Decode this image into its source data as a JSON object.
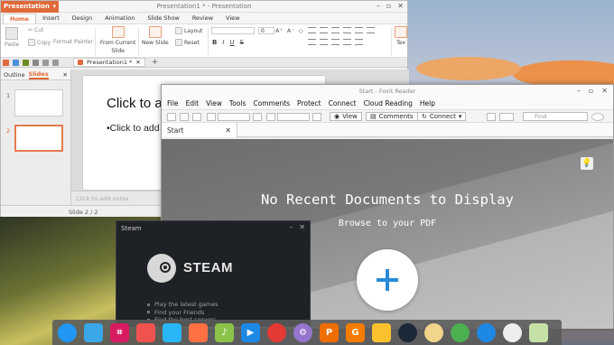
{
  "wps": {
    "app_button": "Presentation",
    "window_title": "Presentation1 * - Presentation",
    "tabs": [
      "Home",
      "Insert",
      "Design",
      "Animation",
      "Slide Show",
      "Review",
      "View"
    ],
    "ribbon": {
      "paste": "Paste",
      "cut": "Cut",
      "copy": "Copy",
      "format_painter": "Format Painter",
      "from_current": "From Current",
      "slide_label": "Slide",
      "new_slide": "New Slide",
      "layout": "Layout",
      "reset": "Reset",
      "font_size": "0",
      "bold": "B",
      "italic": "I",
      "underline": "U",
      "strike": "S",
      "text_label": "Tex"
    },
    "doc_tab": "Presentation1 *",
    "side_tabs": [
      "Outline",
      "Slides"
    ],
    "slides": [
      "1",
      "2"
    ],
    "slide_title": "Click to a",
    "slide_body": "•Click to add",
    "notes_placeholder": "Click to add notes",
    "status": "Slide 2 / 2"
  },
  "foxit": {
    "window_title": "Start - Foxit Reader",
    "menu": [
      "File",
      "Edit",
      "View",
      "Tools",
      "Comments",
      "Protect",
      "Connect",
      "Cloud Reading",
      "Help"
    ],
    "toolbar": {
      "view": "View",
      "comments": "Comments",
      "connect": "Connect",
      "find_placeholder": "Find"
    },
    "tab": "Start",
    "heading": "No Recent Documents to Display",
    "subheading": "Browse to your PDF"
  },
  "steam": {
    "window_title": "Steam",
    "wordmark": "STEAM",
    "items": [
      "Play the latest games",
      "Find your Friends",
      "Find the best servers"
    ]
  },
  "dock": {
    "icons": [
      {
        "name": "launcher",
        "color": "#2196f3",
        "glyph": "",
        "round": true
      },
      {
        "name": "file-manager",
        "color": "#3aa7e8",
        "glyph": "",
        "round": false
      },
      {
        "name": "screenshot",
        "color": "#d81b60",
        "glyph": "⌗",
        "round": false
      },
      {
        "name": "screen-recorder",
        "color": "#ef5350",
        "glyph": "",
        "round": false
      },
      {
        "name": "app-store",
        "color": "#29b6f6",
        "glyph": "",
        "round": false
      },
      {
        "name": "calendar",
        "color": "#ff7043",
        "glyph": "",
        "round": false
      },
      {
        "name": "music",
        "color": "#8bc34a",
        "glyph": "♪",
        "round": false
      },
      {
        "name": "video",
        "color": "#1e88e5",
        "glyph": "▶",
        "round": false
      },
      {
        "name": "chrome",
        "color": "#e53935",
        "glyph": "",
        "round": true
      },
      {
        "name": "settings",
        "color": "#9575cd",
        "glyph": "⚙",
        "round": true
      },
      {
        "name": "wps-presentation",
        "color": "#ef6c00",
        "glyph": "P",
        "round": false
      },
      {
        "name": "foxit",
        "color": "#f57c00",
        "glyph": "G",
        "round": false
      },
      {
        "name": "text-editor",
        "color": "#fbc02d",
        "glyph": "",
        "round": false
      },
      {
        "name": "steam",
        "color": "#1b2838",
        "glyph": "",
        "round": true
      },
      {
        "name": "app-yellow",
        "color": "#f0d58a",
        "glyph": "",
        "round": true
      },
      {
        "name": "update",
        "color": "#4caf50",
        "glyph": "",
        "round": true
      },
      {
        "name": "wifi",
        "color": "#1e88e5",
        "glyph": "",
        "round": true
      },
      {
        "name": "disk",
        "color": "#eeeeee",
        "glyph": "",
        "round": true
      },
      {
        "name": "trash",
        "color": "#c5e1a5",
        "glyph": "",
        "round": false
      }
    ]
  }
}
